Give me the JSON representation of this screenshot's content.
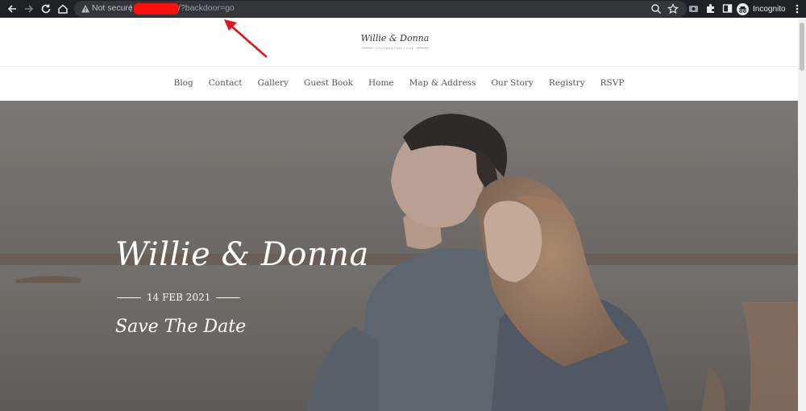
{
  "browser": {
    "security_label": "Not secure",
    "separator": "|",
    "url_path": "/?backdoor=go",
    "incognito_label": "Incognito",
    "icons": [
      "back-arrow-icon",
      "forward-arrow-icon",
      "reload-icon",
      "home-icon",
      "warning-icon",
      "zoom-icon",
      "star-icon",
      "screenshot-icon",
      "extensions-icon",
      "sidebar-icon",
      "incognito-icon",
      "more-menu-icon"
    ]
  },
  "site": {
    "logo_title": "Willie & Donna",
    "logo_subtitle": "CELEBRATING LOVE"
  },
  "nav": {
    "items": [
      "Blog",
      "Contact",
      "Gallery",
      "Guest Book",
      "Home",
      "Map & Address",
      "Our Story",
      "Registry",
      "RSVP"
    ]
  },
  "hero": {
    "title": "Willie & Donna",
    "date": "14 FEB 2021",
    "subtitle": "Save The Date"
  },
  "colors": {
    "chrome_bg": "#202124",
    "omnibox_bg": "#35363a",
    "redaction": "#ff1010",
    "annotation_arrow": "#e0161b",
    "nav_text": "#555555"
  }
}
